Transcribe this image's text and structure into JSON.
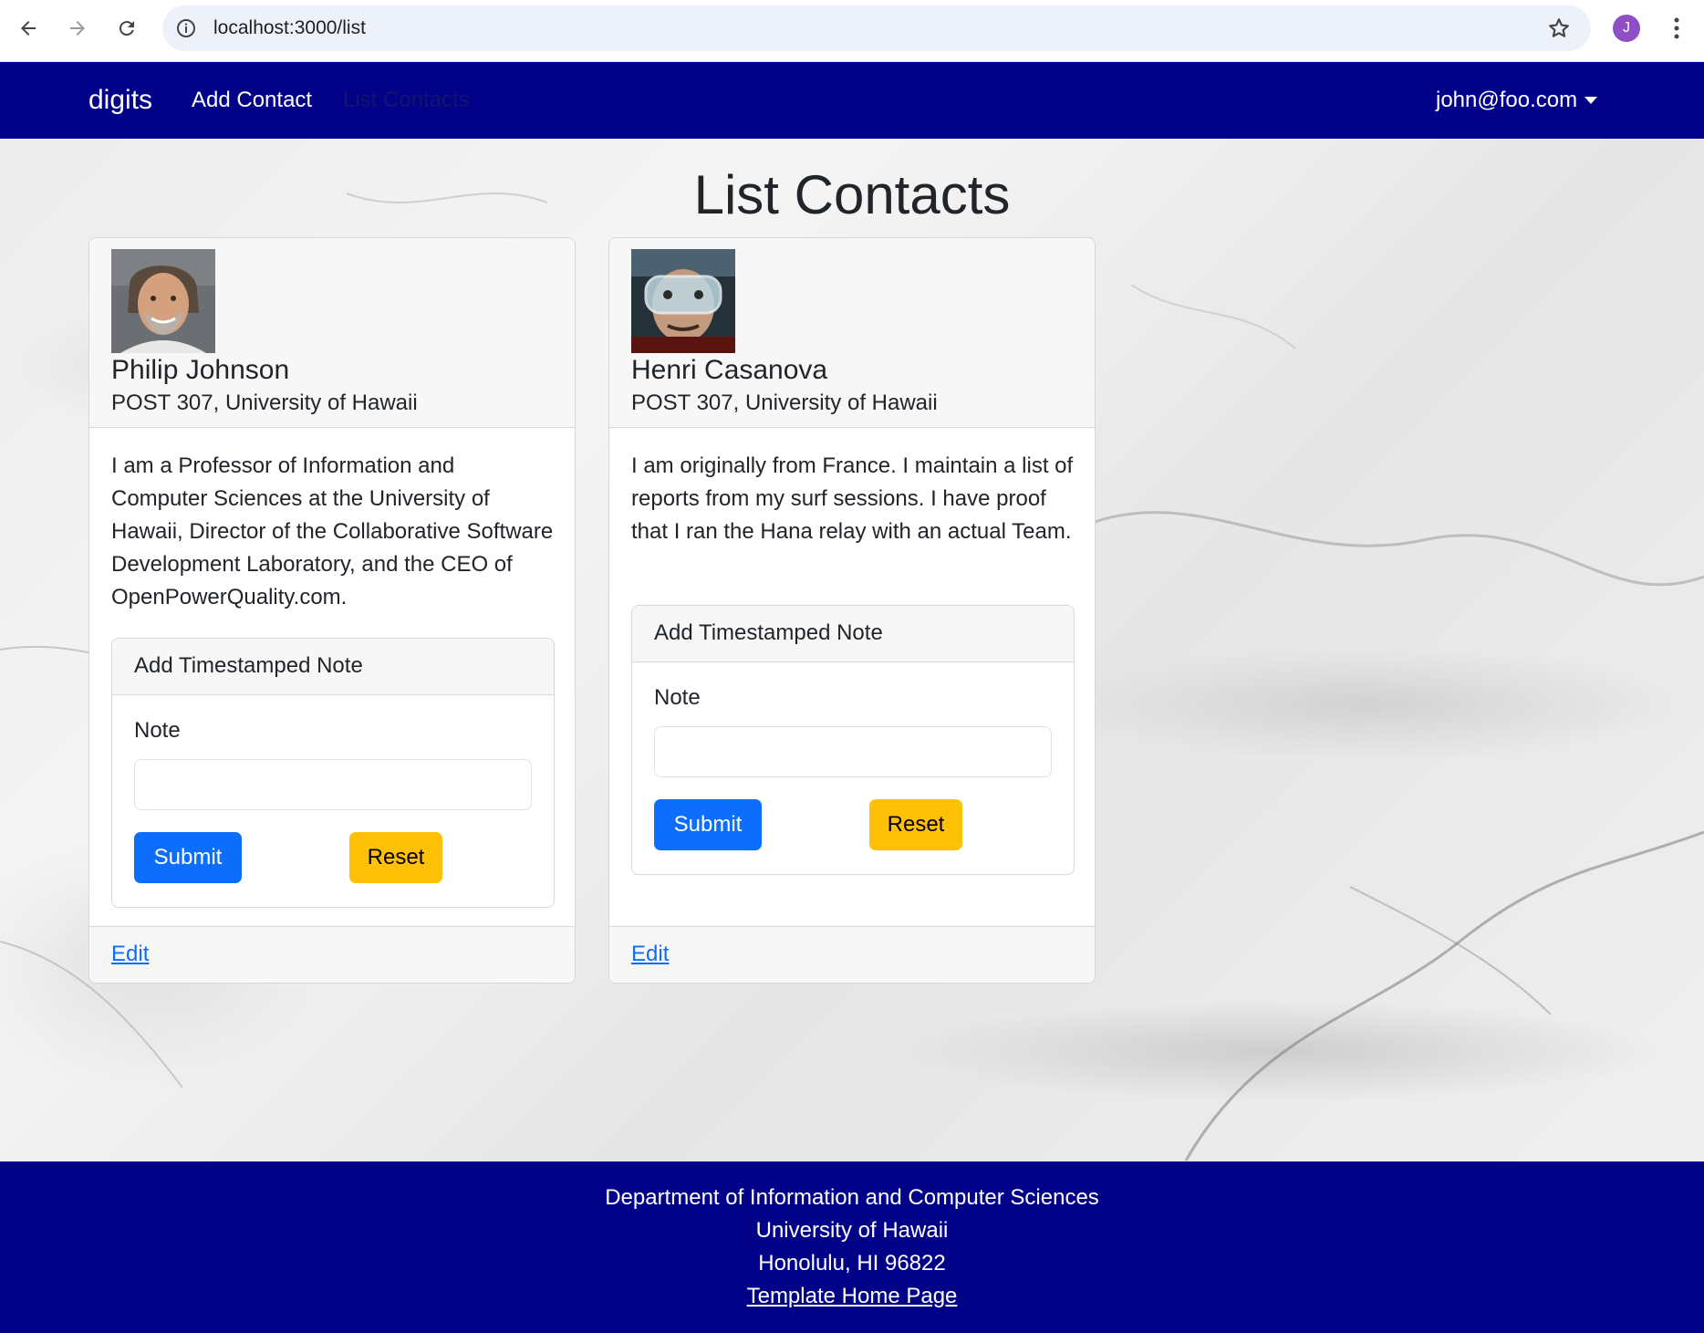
{
  "browser": {
    "url": "localhost:3000/list",
    "profile_initial": "J"
  },
  "navbar": {
    "brand": "digits",
    "links": [
      {
        "label": "Add Contact"
      },
      {
        "label": "List Contacts"
      }
    ],
    "user": "john@foo.com"
  },
  "page": {
    "title": "List Contacts"
  },
  "contacts": [
    {
      "name": "Philip Johnson",
      "address": "POST 307, University of Hawaii",
      "description": "I am a Professor of Information and Computer Sciences at the University of Hawaii, Director of the Collaborative Software Development Laboratory, and the CEO of OpenPowerQuality.com.",
      "note_header": "Add Timestamped Note",
      "note_label": "Note",
      "note_value": "",
      "submit_label": "Submit",
      "reset_label": "Reset",
      "edit_label": "Edit"
    },
    {
      "name": "Henri Casanova",
      "address": "POST 307, University of Hawaii",
      "description": "I am originally from France. I maintain a list of reports from my surf sessions. I have proof that I ran the Hana relay with an actual Team.",
      "note_header": "Add Timestamped Note",
      "note_label": "Note",
      "note_value": "",
      "submit_label": "Submit",
      "reset_label": "Reset",
      "edit_label": "Edit"
    }
  ],
  "footer": {
    "line1": "Department of Information and Computer Sciences",
    "line2": "University of Hawaii",
    "line3": "Honolulu, HI 96822",
    "link": "Template Home Page"
  },
  "colors": {
    "navbar": "#020288",
    "submit": "#0d6efd",
    "reset": "#ffc107",
    "link": "#0d6efd"
  }
}
